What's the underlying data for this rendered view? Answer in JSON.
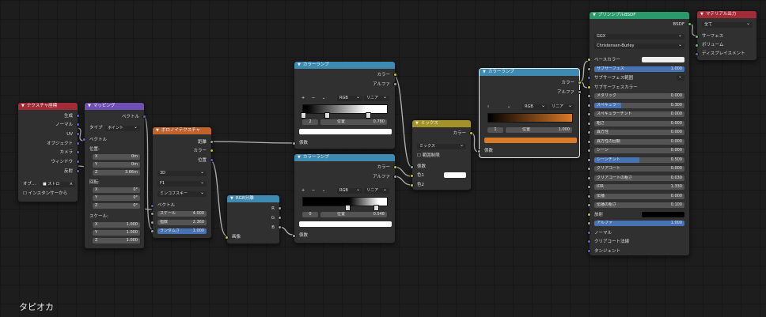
{
  "frame_label": "タピオカ",
  "colors": {
    "texcoord_header": "#a12b36",
    "vector_header": "#6f4fb3",
    "texture_header": "#c0622c",
    "converter_header": "#3e8ab0",
    "mix_header": "#a3922a",
    "shader_header": "#2a9a6c",
    "output_header": "#a12b36",
    "blue_field": "#4772b3"
  },
  "texcoord": {
    "title": "テクスチャ座標",
    "outputs": [
      "生成",
      "ノーマル",
      "UV",
      "オブジェクト",
      "カメラ",
      "ウィンドウ",
      "反射"
    ],
    "object_label": "オブ...",
    "object_value": "ストロ",
    "instancer_label": "インスタンサーから"
  },
  "mapping": {
    "title": "マッピング",
    "output": "ベクトル",
    "type_label": "タイプ",
    "type_value": "ポイント",
    "vector_in": "ベクトル",
    "location_label": "位置:",
    "location": [
      {
        "a": "X",
        "v": "0m"
      },
      {
        "a": "Y",
        "v": "0m"
      },
      {
        "a": "Z",
        "v": "3.66m"
      }
    ],
    "rotation_label": "回転:",
    "rotation": [
      {
        "a": "X",
        "v": "0°"
      },
      {
        "a": "Y",
        "v": "0°"
      },
      {
        "a": "Z",
        "v": "0°"
      }
    ],
    "scale_label": "スケール:",
    "scale": [
      {
        "a": "X",
        "v": "1.000"
      },
      {
        "a": "Y",
        "v": "1.000"
      },
      {
        "a": "Z",
        "v": "1.000"
      }
    ]
  },
  "voronoi": {
    "title": "ボロノイテクスチャ",
    "outputs": [
      "距離",
      "カラー",
      "位置"
    ],
    "dim": "3D",
    "feature": "F1",
    "metric": "ミンコフスキー",
    "vector_in": "ベクトル",
    "scale_label": "スケール",
    "scale_value": "4.000",
    "exp_label": "指数",
    "exp_value": "2.360",
    "rand_label": "ランダムさ",
    "rand_value": "1.000"
  },
  "sep_rgb": {
    "title": "RGB分離",
    "outputs": [
      "R",
      "G",
      "B"
    ],
    "input": "画像"
  },
  "ramp1": {
    "title": "カラーランプ",
    "outputs": [
      "カラー",
      "アルファ"
    ],
    "plus": "+",
    "minus": "−",
    "more": "⌄",
    "mode": "RGB",
    "interp": "リニア",
    "index": "2",
    "pos_label": "位置",
    "pos_value": "0.780",
    "input": "係数"
  },
  "ramp2": {
    "title": "カラーランプ",
    "outputs": [
      "カラー",
      "アルファ"
    ],
    "plus": "+",
    "minus": "−",
    "more": "⌄",
    "mode": "RGB",
    "interp": "リニア",
    "index": "0",
    "pos_label": "位置",
    "pos_value": "0.548",
    "input": "係数"
  },
  "mix": {
    "title": "ミックス",
    "output": "カラー",
    "mode": "ミックス",
    "clamp": "範囲制限",
    "fac": "係数",
    "c1": "色1",
    "c2": "色2"
  },
  "ramp3": {
    "title": "カラーランプ",
    "outputs": [
      "カラー",
      "アルファ"
    ],
    "plus": "+",
    "minus": "−",
    "more": "⌄",
    "mode": "RGB",
    "interp": "リニア",
    "index": "1",
    "pos_label": "位置",
    "pos_value": "1.000",
    "input": "係数",
    "stop_color": "#d97a28"
  },
  "bsdf": {
    "title": "プリンシプルBSDF",
    "output": "BSDF",
    "dist": "GGX",
    "sss_method": "Christensen-Burley",
    "rows": [
      {
        "label": "ベースカラー",
        "kind": "color",
        "value": "",
        "sock": "col"
      },
      {
        "label": "サブサーフェス",
        "kind": "blue",
        "value": "1.000",
        "sock": "flt",
        "p": "100%"
      },
      {
        "label": "サブサーフェス範囲",
        "kind": "dd",
        "value": "",
        "sock": "vec"
      },
      {
        "label": "サブサーフェスカラー",
        "kind": "text",
        "value": "",
        "sock": "col"
      },
      {
        "label": "メタリック",
        "kind": "num",
        "value": "0.000",
        "sock": "flt"
      },
      {
        "label": "スペキュラー",
        "kind": "blue",
        "value": "0.300",
        "sock": "flt",
        "p": "30%"
      },
      {
        "label": "スペキュラーチント",
        "kind": "num",
        "value": "0.000",
        "sock": "flt"
      },
      {
        "label": "粗さ",
        "kind": "num",
        "value": "0.000",
        "sock": "flt"
      },
      {
        "label": "異方性",
        "kind": "num",
        "value": "0.000",
        "sock": "flt"
      },
      {
        "label": "異方性の回転",
        "kind": "num",
        "value": "0.000",
        "sock": "flt"
      },
      {
        "label": "シーン",
        "kind": "num",
        "value": "0.000",
        "sock": "flt"
      },
      {
        "label": "シーンチント",
        "kind": "blue",
        "value": "0.500",
        "sock": "flt",
        "p": "50%"
      },
      {
        "label": "クリアコート",
        "kind": "num",
        "value": "0.000",
        "sock": "flt"
      },
      {
        "label": "クリアコートの粗さ",
        "kind": "num",
        "value": "0.030",
        "sock": "flt"
      },
      {
        "label": "IOR",
        "kind": "num",
        "value": "1.330",
        "sock": "flt"
      },
      {
        "label": "伝播",
        "kind": "num",
        "value": "0.000",
        "sock": "flt"
      },
      {
        "label": "伝播の粗さ",
        "kind": "num",
        "value": "0.100",
        "sock": "flt"
      },
      {
        "label": "放射",
        "kind": "black",
        "value": "",
        "sock": "col"
      },
      {
        "label": "アルファ",
        "kind": "blue",
        "value": "1.000",
        "sock": "flt",
        "p": "100%"
      },
      {
        "label": "ノーマル",
        "kind": "text",
        "value": "",
        "sock": "vec"
      },
      {
        "label": "クリアコート法線",
        "kind": "text",
        "value": "",
        "sock": "vec"
      },
      {
        "label": "タンジェント",
        "kind": "text",
        "value": "",
        "sock": "vec"
      }
    ]
  },
  "output": {
    "title": "マテリアル出力",
    "target": "全て",
    "inputs": [
      "サーフェス",
      "ボリューム",
      "ディスプレイスメント"
    ]
  }
}
